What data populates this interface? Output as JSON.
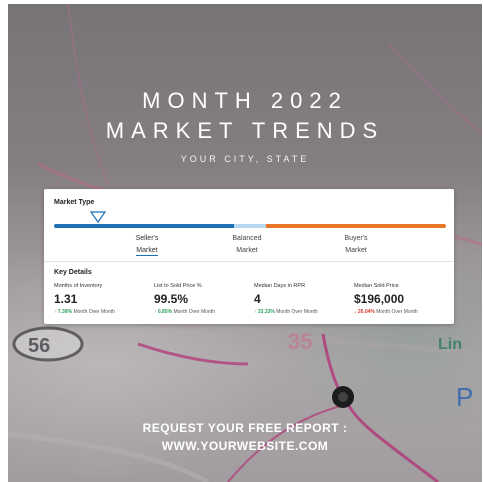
{
  "header": {
    "title_line1": "MONTH 2022",
    "title_line2": "MARKET TRENDS",
    "subtitle": "YOUR CITY, STATE"
  },
  "card": {
    "market_type_label": "Market Type",
    "market_options": [
      {
        "line1": "Seller's",
        "line2": "Market"
      },
      {
        "line1": "Balanced",
        "line2": "Market"
      },
      {
        "line1": "Buyer's",
        "line2": "Market"
      }
    ],
    "selected_market": "Seller's Market",
    "colors": {
      "seller": "#1f6fb5",
      "balanced": "#b9d8f1",
      "buyer": "#e8772a"
    },
    "key_details_label": "Key Details",
    "metrics": [
      {
        "name": "Months of Inventory",
        "value": "1.31",
        "change": "7.38%",
        "change_label": "Month Over Month",
        "direction": "up"
      },
      {
        "name": "List to Sold Price %",
        "value": "99.5%",
        "change": "0.85%",
        "change_label": "Month Over Month",
        "direction": "up"
      },
      {
        "name": "Median Days in RPR",
        "value": "4",
        "change": "33.33%",
        "change_label": "Month Over Month",
        "direction": "up"
      },
      {
        "name": "Median Sold Price",
        "value": "$196,000",
        "change": "26.04%",
        "change_label": "Month Over Month",
        "direction": "down"
      }
    ]
  },
  "cta": {
    "line1": "REQUEST YOUR FREE REPORT :",
    "line2": "WWW.YOURWEBSITE.COM"
  },
  "background": {
    "map_labels": [
      "56",
      "35",
      "Lin",
      "P"
    ],
    "icons": [
      "route-marker-icon"
    ]
  }
}
